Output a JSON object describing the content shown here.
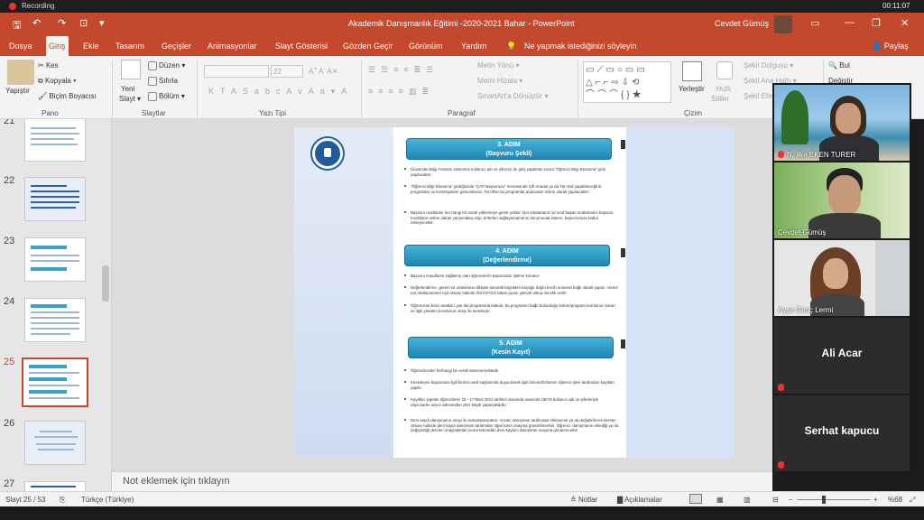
{
  "recording": {
    "label": "Recording",
    "clock": "00:11:07"
  },
  "titlebar": {
    "title": "Akademik Danışmanlık Eğitimi -2020-2021 Bahar  -  PowerPoint",
    "user": "Cevdet Gümüş"
  },
  "tabs": [
    "Dosya",
    "Giriş",
    "Ekle",
    "Tasarım",
    "Geçişler",
    "Animasyonlar",
    "Slayt Gösterisi",
    "Gözden Geçir",
    "Görünüm",
    "Yardım"
  ],
  "tell_me": "Ne yapmak istediğinizi söyleyin",
  "share": "Paylaş",
  "ribbon": {
    "paste": "Yapıştır",
    "cut": "Kes",
    "copy": "Kopyala",
    "format_painter": "Biçim Boyacısı",
    "new_slide_1": "Yeni",
    "new_slide_2": "Slayt",
    "layout": "Düzen",
    "reset": "Sıfırla",
    "section": "Bölüm",
    "font_size": "22",
    "text_direction": "Metin Yönü",
    "align_text": "Metni Hizala",
    "smartart": "SmartArt'a Dönüştür",
    "arrange_1": "Yerleştir",
    "quick_styles_1": "Hızlı",
    "quick_styles_2": "Stiller",
    "shape_fill": "Şekil Dolgusu",
    "shape_outline": "Şekil Ana Hattı",
    "shape_effects": "Şekil Efektleri",
    "find": "Bul",
    "replace": "Değiştir",
    "groups": {
      "clipboard": "Pano",
      "slides": "Slaytlar",
      "font": "Yazı Tipi",
      "paragraph": "Paragraf",
      "drawing": "Çizim"
    }
  },
  "slide_numbers": [
    "21",
    "22",
    "23",
    "24",
    "25",
    "26",
    "27"
  ],
  "slide": {
    "steps": [
      {
        "title": "3. ADIM",
        "sub": "(Başvuru Şekli)"
      },
      {
        "title": "4. ADIM",
        "sub": "(Değerlendirme)"
      },
      {
        "title": "5. ADIM",
        "sub": "(Kesin Kayıt)"
      }
    ],
    "p3": [
      "Üniversite Bilgi Yönetim sistemine kullanıcı adı ve şifrenizi ile giriş yaptıktan sonra \"Öğrenci Bilgi Ekranına\" giriş yapılacaktır.",
      "\"Öğrenci Bilgi Ekranına\" girdiğinizde \"ÇAP Başvurusu\" menüsünde Çift Anadal ya da Yan Dal yapabileceğiniz programlar ve kontenjanları göreceksiniz. Tercihler bu programlar arasından online olarak yapılacaktır.",
      "Başvuru modülüne her hangi bir evrak yüklemeye gerek yoktur. Not ortalamanız ve sınıf başarı sıralamanız başvuru modülüne online olarak yansımakta olup, kriterleri sağlayamamanız durumunda sistem, başvurunuzu kabul etmeyecektir."
    ],
    "p4": [
      "Başvuru koşullarını sağlamış olan öğrencilerin başvuruları işleme konulur.",
      "Değerlendirme, genel not ortalaması dikkate alınarak büyükten küçüğe doğru tercih sırasına bağlı olarak yapılır. Genel not ortalamasının eşit olması halinde ÖSYS/YKS taban puanı yüksek olana öncelik verilir.",
      "Öğrencinin ikinci anadal / yan dal programına kabulü, bu programın bağlı bulunduğu bölüm/program kurulunun kararı ve ilgili yönetim kurulunun onayı ile kesinleşir."
    ],
    "p5": [
      "Öğrencilerden herhangi bir evrak istenmemektedir.",
      "Kesinleşen başvurular ilgili birimin web sayfasında duyurularak ilgili birimin/bölümün öğrenci işleri tarafından kayıtları yapılır.",
      "Kayıtları yapılan öğrencilerin 15 - 17 Mart 2021 tarihleri arasında arasında UBYS kullanıcı adı ve şifreleriyle ubys.bartin.edu.tr adresinden ders kaydı yapacaklardır.",
      "Ders kaydı danışmanın onayı ile tamamlanacaktır. Ancak; danışman tarafından eklenecek ya da değiştirilecek dersler olması halinde ders kaydı danışman tarafından öğrencinin onayına gönderilecektir. Öğrenci, danışmanın eklediği ya da değiştirdiği dersleri onayladıktan sonra tekrardan ders kaydını danışman onayına gönderecektir."
    ]
  },
  "notes": "Not eklemek için tıklayın",
  "status": {
    "slide": "Slayt 25 / 53",
    "language": "Türkçe (Türkiye)",
    "notes": "Notlar",
    "comments": "Açıklamalar",
    "zoom": "%68"
  },
  "participants": [
    {
      "name": "N. İlke EKEN TURER",
      "muted": true
    },
    {
      "name": "Cevdet Gümüş",
      "muted": false
    },
    {
      "name": "Ayşe Genç Lermi",
      "muted": false
    },
    {
      "name": "Ali Acar",
      "muted": true
    },
    {
      "name": "Serhat  kapucu",
      "muted": true
    }
  ],
  "colors": {
    "accent": "#c3482c",
    "step": "#2b9bc8"
  }
}
